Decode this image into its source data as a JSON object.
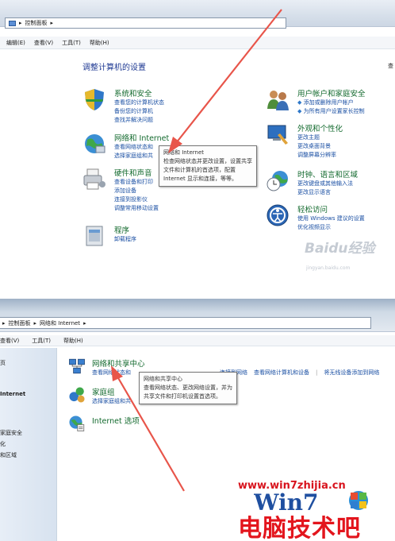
{
  "panel1": {
    "address_path": [
      "控制面板"
    ],
    "menu": [
      "编辑(E)",
      "查看(V)",
      "工具(T)",
      "帮助(H)"
    ],
    "heading": "调整计算机的设置",
    "side_cut": "查",
    "categories": [
      {
        "title": "系统和安全",
        "links": [
          "查看您的计算机状态",
          "备份您的计算机",
          "查找并解决问题"
        ]
      },
      {
        "title": "网络和 Internet",
        "links": [
          "查看网络状态和",
          "选择家庭组和共"
        ]
      },
      {
        "title": "硬件和声音",
        "links": [
          "查看设备和打印",
          "添加设备",
          "连接到投影仪",
          "调整常用移动设置"
        ]
      },
      {
        "title": "程序",
        "links": [
          "卸载程序"
        ]
      },
      {
        "title": "用户帐户和家庭安全",
        "links": [
          "添加或删除用户帐户",
          "为所有用户设置家长控制"
        ]
      },
      {
        "title": "外观和个性化",
        "links": [
          "更改主题",
          "更改桌面背景",
          "调整屏幕分辨率"
        ]
      },
      {
        "title": "时钟、语言和区域",
        "links": [
          "更改键盘或其他输入法",
          "更改显示语言"
        ]
      },
      {
        "title": "轻松访问",
        "links": [
          "使用 Windows 建议的设置",
          "优化视频显示"
        ]
      }
    ],
    "tooltip": [
      "网络和 Internet",
      "检查网络状态并更改设置，设置共享",
      "文件和计算机的首选项，配置",
      "Internet 显示和连接，等等。"
    ],
    "watermark": "Baidu经验",
    "watermark_sub": "jingyan.baidu.com"
  },
  "panel2": {
    "address_path": [
      "控制面板",
      "网络和 Internet"
    ],
    "menu": [
      "查看(V)",
      "工具(T)",
      "帮助(H)"
    ],
    "sidebar": [
      "页",
      "Internet",
      "家庭安全",
      "化",
      "和区域"
    ],
    "items": [
      {
        "title": "网络和共享中心",
        "links": [
          "查看网络状态和",
          "连接到网络",
          "查看网络计算机和设备",
          "将无线设备添加到网络"
        ]
      },
      {
        "title": "家庭组",
        "links": [
          "选择家庭组和共"
        ]
      },
      {
        "title": "Internet 选项",
        "links": []
      }
    ],
    "tooltip": [
      "网络和共享中心",
      "查看网络状态、更改网络设置，并为",
      "共享文件和打印机设置首选项。"
    ],
    "watermark_url": "www.win7zhijia.cn",
    "watermark_brand": "电脑技术吧"
  },
  "colors": {
    "link": "#1a4fa3",
    "category_title": "#136a2e",
    "arrow": "#e8554a",
    "watermark": "#e3151d"
  }
}
